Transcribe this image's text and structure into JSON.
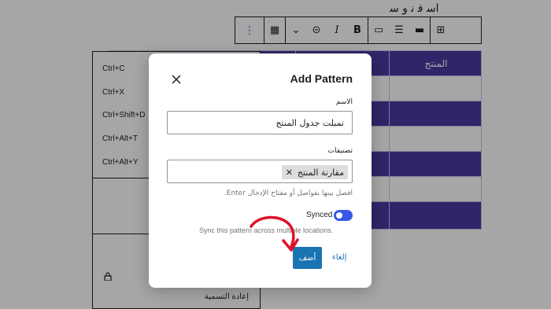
{
  "editor": {
    "heading_fragment": "ﺍﺳ ﻓ ﻧ ﻭ ﺳ",
    "toolbar": {
      "items": [
        {
          "name": "options-icon",
          "glyph": "⋮"
        },
        {
          "name": "table-icon",
          "glyph": "▦"
        },
        {
          "name": "chevron-down-icon",
          "glyph": "⌄"
        },
        {
          "name": "link-icon",
          "glyph": "⊝"
        },
        {
          "name": "italic-icon",
          "glyph": "I"
        },
        {
          "name": "bold-icon",
          "glyph": "B"
        },
        {
          "name": "caption-icon",
          "glyph": "▭"
        },
        {
          "name": "align-icon",
          "glyph": "☰"
        },
        {
          "name": "width-icon",
          "glyph": "▬"
        },
        {
          "name": "table-settings-icon",
          "glyph": "⊞"
        }
      ]
    },
    "table": {
      "header_cell": "المنتج"
    },
    "block_menu": {
      "shortcuts": [
        "Ctrl+C",
        "Ctrl+X",
        "Ctrl+Shift+D",
        "Ctrl+Alt+T",
        "Ctrl+Alt+Y"
      ],
      "rename_label": "إعادة التسمية"
    }
  },
  "modal": {
    "title": "Add Pattern",
    "name_label": "الاسم",
    "name_value": "تمبلت جدول المنتج",
    "categories_label": "تصنيفات",
    "category_token": "مقارنة المنتج",
    "categories_help": "افصل بينها بفواصل أو مفتاح الإدخال Enter.",
    "synced_label": "Synced",
    "synced_on": true,
    "synced_help": "Sync this pattern across multiple locations.",
    "add_button": "أضف",
    "cancel_button": "إلغاء"
  },
  "colors": {
    "accent": "#3858e9",
    "table_purple": "#4a3aa0",
    "primary_button": "#1a73b3",
    "annotation_arrow": "#e0102a"
  }
}
